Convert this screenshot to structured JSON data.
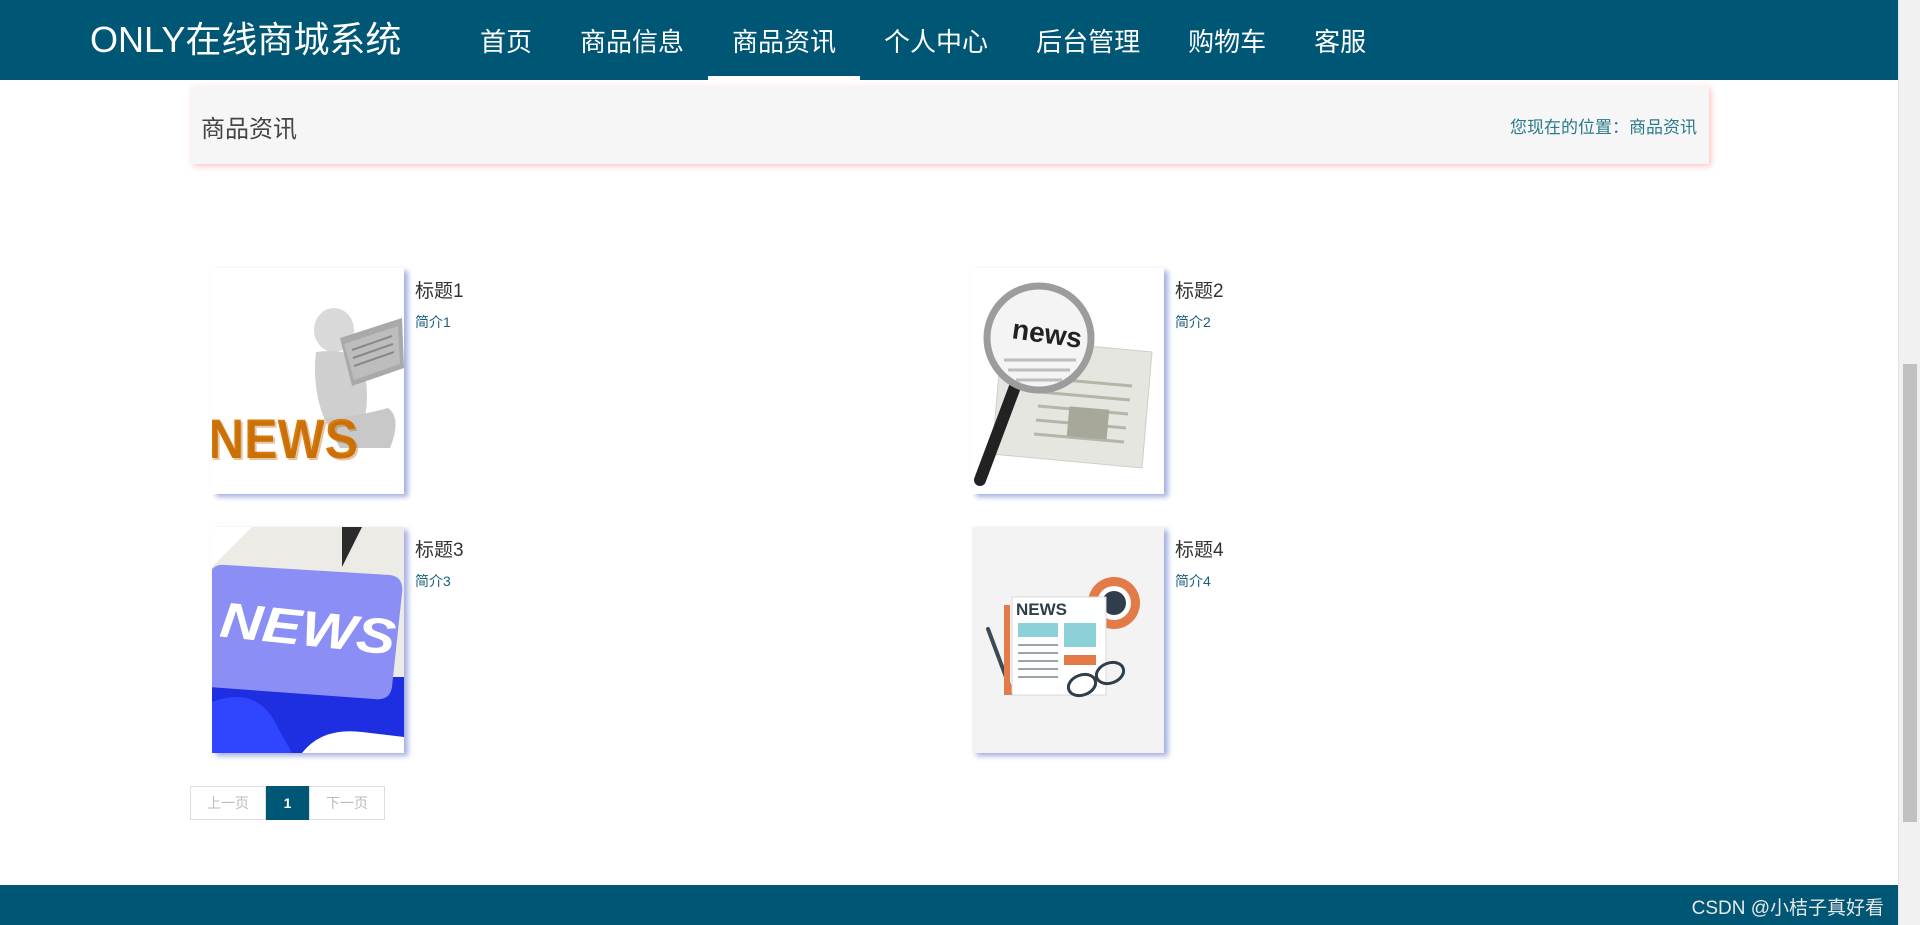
{
  "header": {
    "brand": "ONLY在线商城系统",
    "nav": [
      {
        "label": "首页"
      },
      {
        "label": "商品信息"
      },
      {
        "label": "商品资讯"
      },
      {
        "label": "个人中心"
      },
      {
        "label": "后台管理"
      },
      {
        "label": "购物车"
      },
      {
        "label": "客服"
      }
    ],
    "active_nav": "商品资讯"
  },
  "breadcrumb": {
    "title": "商品资讯",
    "location": "您现在的位置：商品资讯"
  },
  "news": [
    {
      "title": "标题1",
      "intro": "简介1",
      "image": "news-3d-figure-image"
    },
    {
      "title": "标题2",
      "intro": "简介2",
      "image": "news-magnifier-image"
    },
    {
      "title": "标题3",
      "intro": "简介3",
      "image": "news-keyboard-key-image"
    },
    {
      "title": "标题4",
      "intro": "简介4",
      "image": "news-flat-illustration-image"
    }
  ],
  "pagination": {
    "prev": "上一页",
    "current": "1",
    "next": "下一页"
  },
  "footer": {
    "watermark": "CSDN @小桔子真好看"
  },
  "colors": {
    "primary": "#005675",
    "breadcrumb_bg": "#f6f6f6",
    "link": "#2a7a8c"
  }
}
